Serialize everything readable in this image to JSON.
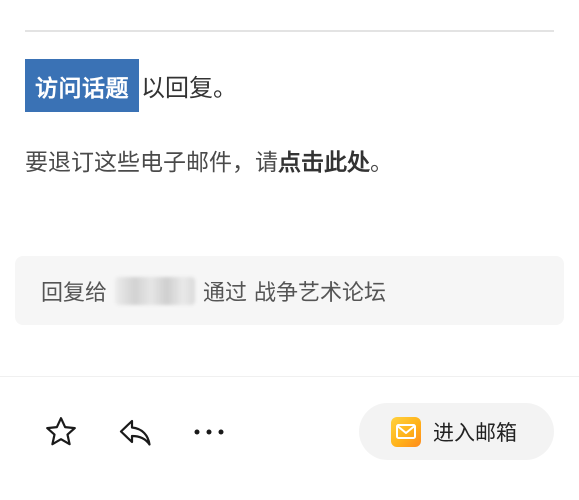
{
  "message": {
    "topic_button_label": "访问话题",
    "reply_suffix": "以回复。",
    "unsubscribe_prefix": "要退订这些电子邮件，请",
    "unsubscribe_link": "点击此处",
    "unsubscribe_suffix": "。"
  },
  "reply_card": {
    "prefix": "回复给",
    "via_text": "通过 战争艺术论坛"
  },
  "toolbar": {
    "icons": [
      "star-icon",
      "reply-icon",
      "more-icon"
    ],
    "mailbox_label": "进入邮箱",
    "mailbox_icon": "mail-icon"
  },
  "colors": {
    "topic_button_bg": "#3a72b5",
    "mail_icon_gradient": [
      "#ffd23f",
      "#ff8a1c"
    ]
  }
}
